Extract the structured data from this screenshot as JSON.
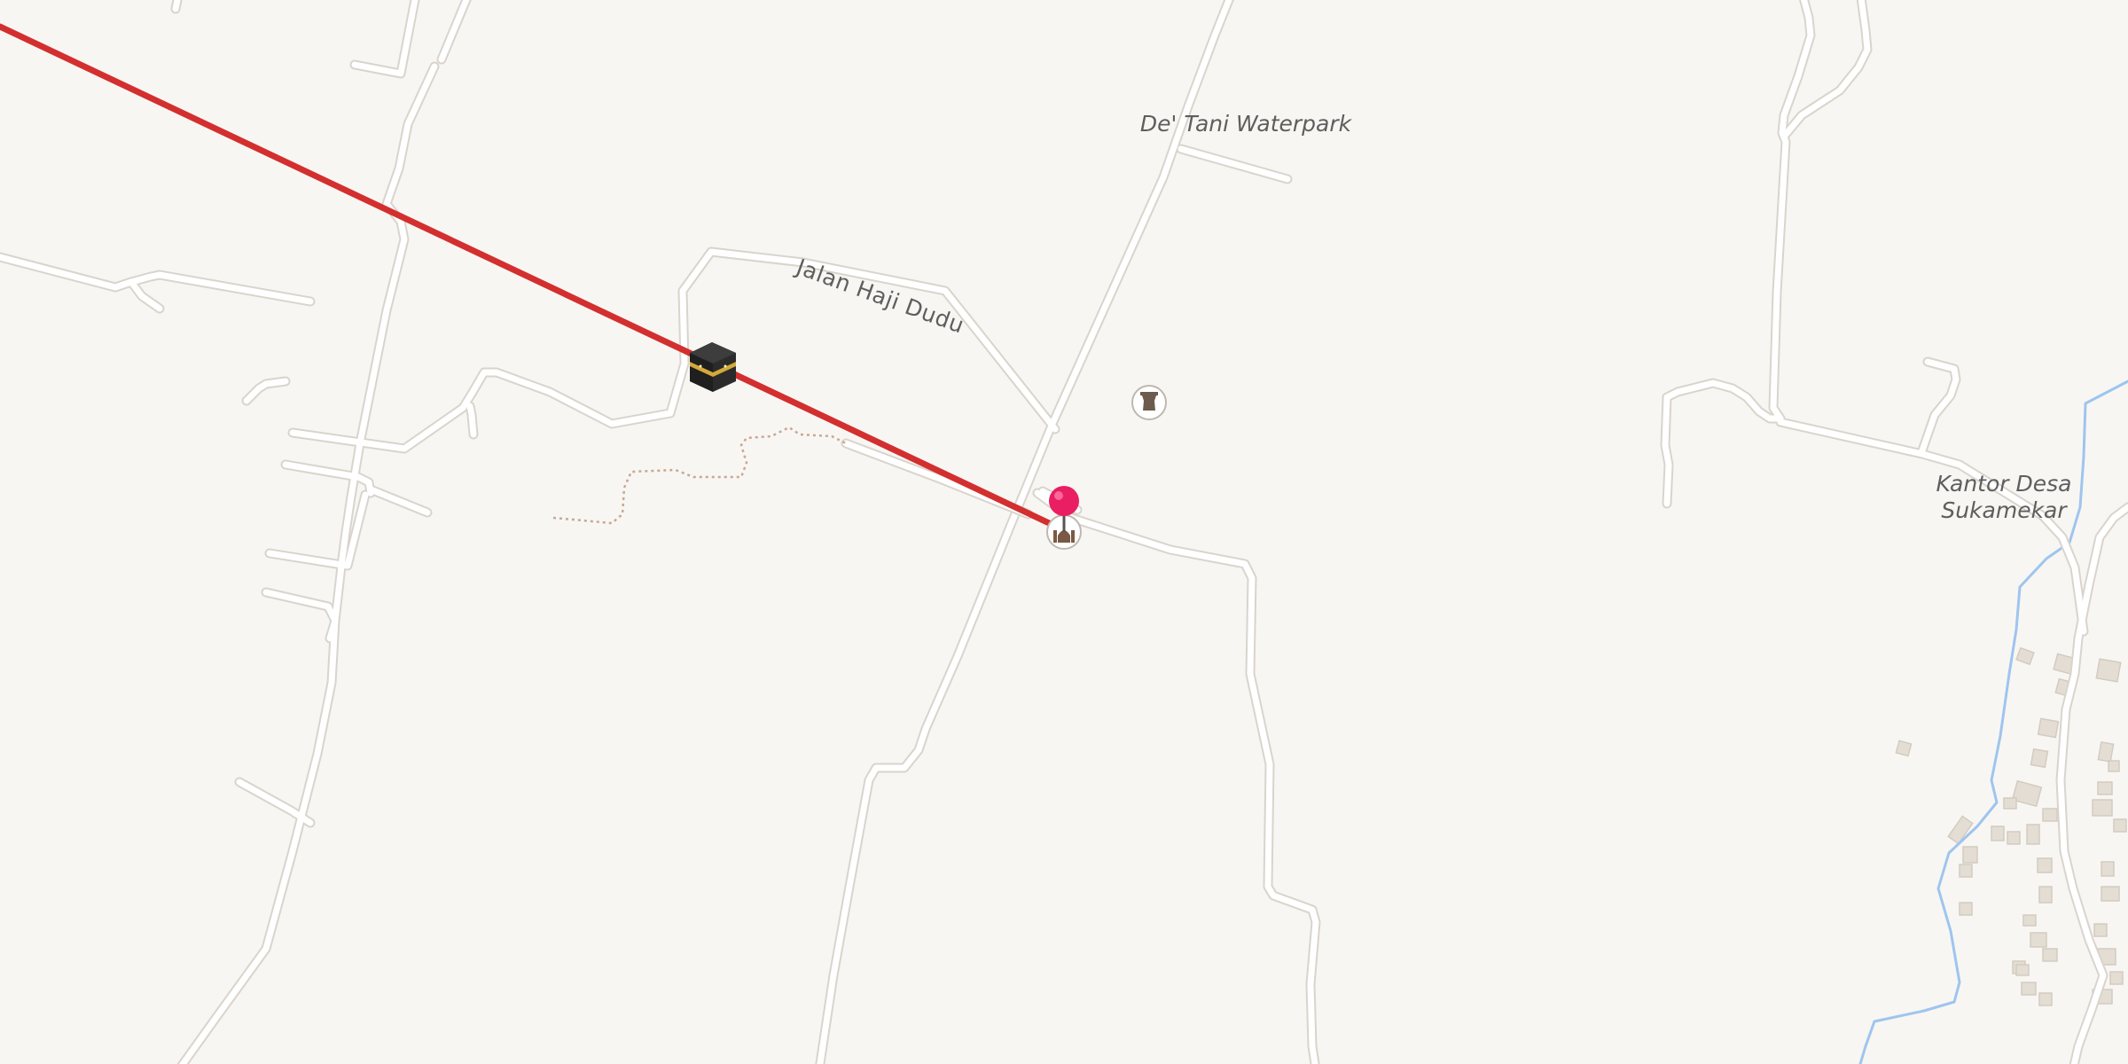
{
  "map": {
    "labels": {
      "waterpark": "De' Tani Waterpark",
      "road": "Jalan  Haji Dudu",
      "kantor_line1": "Kantor Desa",
      "kantor_line2": "Sukamekar"
    },
    "route_color": "#d32f2f",
    "pin_color": "#e91e63",
    "water_color": "#9ec5ee",
    "background_color": "#f8f6f3",
    "icons": [
      "kaaba-icon",
      "monument-icon",
      "mosque-icon",
      "map-pin-icon"
    ]
  }
}
